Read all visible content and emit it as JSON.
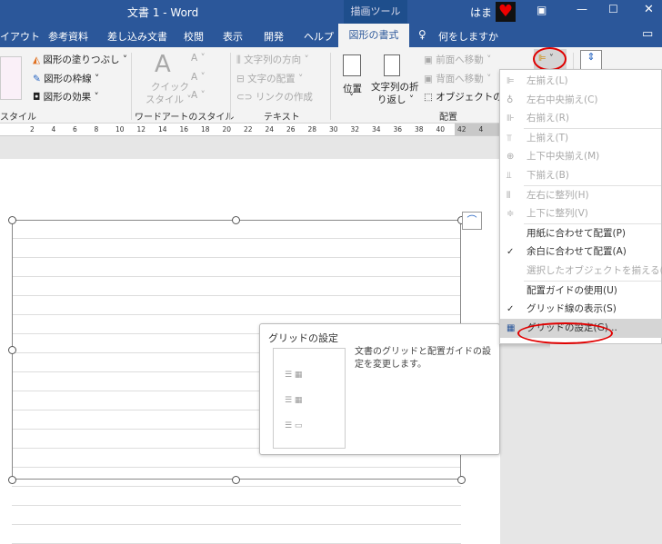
{
  "titlebar": {
    "title": "文書 1  -  Word",
    "context_tab": "描画ツール",
    "user": "はま",
    "buttons": [
      "ribbon-display-icon",
      "minimize-icon",
      "maximize-icon",
      "close-icon"
    ]
  },
  "tabs": [
    {
      "label": "イアウト"
    },
    {
      "label": "参考資料"
    },
    {
      "label": "差し込み文書"
    },
    {
      "label": "校閲"
    },
    {
      "label": "表示"
    },
    {
      "label": "開発"
    },
    {
      "label": "ヘルプ"
    },
    {
      "label": "図形の書式",
      "active": true
    },
    {
      "label": "何をしますか"
    }
  ],
  "ribbon": {
    "shape_styles": {
      "fill": "図形の塗りつぶし",
      "outline": "図形の枠線",
      "effect": "図形の効果",
      "group": "スタイル"
    },
    "wordart": {
      "quick": "クイック",
      "style": "スタイル",
      "group": "ワードアートのスタイル"
    },
    "text": {
      "direction": "文字列の方向",
      "align": "文字の配置",
      "link": "リンクの作成",
      "group": "テキスト"
    },
    "arrange": {
      "position": "位置",
      "wrap1": "文字列の折",
      "wrap2": "り返し",
      "forward": "前面へ移動",
      "backward": "背面へ移動",
      "select": "オブジェクトの選択",
      "group": "配置"
    }
  },
  "ruler": [
    "2",
    "4",
    "6",
    "8",
    "10",
    "12",
    "14",
    "16",
    "18",
    "20",
    "22",
    "24",
    "26",
    "28",
    "30",
    "32",
    "34",
    "36",
    "38",
    "40",
    "42",
    "4"
  ],
  "menu": {
    "items": [
      {
        "label": "左揃え(L)",
        "icon": "align-left-icon",
        "enabled": false
      },
      {
        "label": "左右中央揃え(C)",
        "icon": "align-center-icon",
        "enabled": false
      },
      {
        "label": "右揃え(R)",
        "icon": "align-right-icon",
        "enabled": false
      },
      {
        "label": "上揃え(T)",
        "icon": "align-top-icon",
        "enabled": false,
        "sep": true
      },
      {
        "label": "上下中央揃え(M)",
        "icon": "align-middle-icon",
        "enabled": false
      },
      {
        "label": "下揃え(B)",
        "icon": "align-bottom-icon",
        "enabled": false
      },
      {
        "label": "左右に整列(H)",
        "icon": "distribute-horizontal-icon",
        "enabled": false,
        "sep": true
      },
      {
        "label": "上下に整列(V)",
        "icon": "distribute-vertical-icon",
        "enabled": false
      },
      {
        "label": "用紙に合わせて配置(P)",
        "enabled": true,
        "sep": true
      },
      {
        "label": "余白に合わせて配置(A)",
        "enabled": true,
        "checked": true
      },
      {
        "label": "選択したオブジェクトを揃える(O)",
        "enabled": false
      },
      {
        "label": "配置ガイドの使用(U)",
        "enabled": true,
        "sep": true
      },
      {
        "label": "グリッド線の表示(S)",
        "enabled": true,
        "checked": true
      },
      {
        "label": "グリッドの設定(G)...",
        "icon": "grid-icon",
        "enabled": true,
        "highlighted": true
      }
    ]
  },
  "tooltip": {
    "title": "グリッドの設定",
    "description": "文書のグリッドと配置ガイドの設定を変更します。"
  },
  "colors": {
    "brand": "#2b579a",
    "highlight": "#d5d5d5",
    "annotation": "#e00000"
  }
}
